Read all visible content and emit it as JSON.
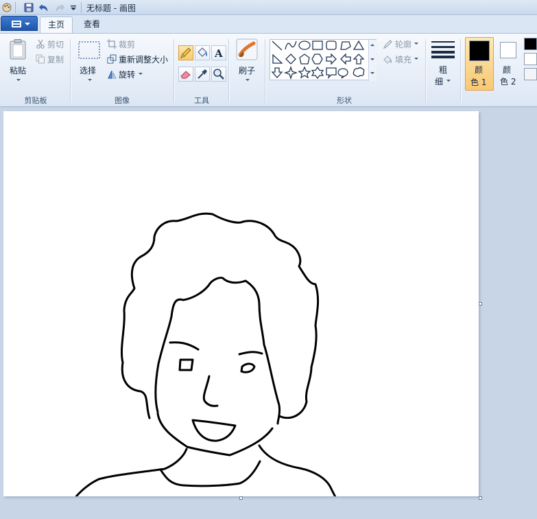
{
  "window": {
    "title": "无标题 - 画图"
  },
  "tabs": [
    {
      "label": "主页",
      "active": true
    },
    {
      "label": "查看",
      "active": false
    }
  ],
  "ribbon": {
    "clipboard": {
      "label": "剪贴板",
      "paste": "粘贴",
      "cut": "剪切",
      "copy": "复制"
    },
    "image": {
      "label": "图像",
      "select": "选择",
      "crop": "裁剪",
      "resize": "重新调整大小",
      "rotate": "旋转"
    },
    "tools": {
      "label": "工具"
    },
    "brushes": {
      "label": "刷子"
    },
    "shapes": {
      "label": "形状",
      "outline": "轮廓",
      "fill": "填充"
    },
    "size": {
      "label_line1": "粗",
      "label_line2": "细"
    },
    "color1": {
      "label_line1": "颜",
      "label_line2": "色 1",
      "color": "#000000"
    },
    "color2": {
      "label_line1": "颜",
      "label_line2": "色 2",
      "color": "#ffffff"
    }
  },
  "colors": {
    "accent": "#1c56ad",
    "selected_tool": "#f8c96a",
    "ink": "#000000"
  }
}
